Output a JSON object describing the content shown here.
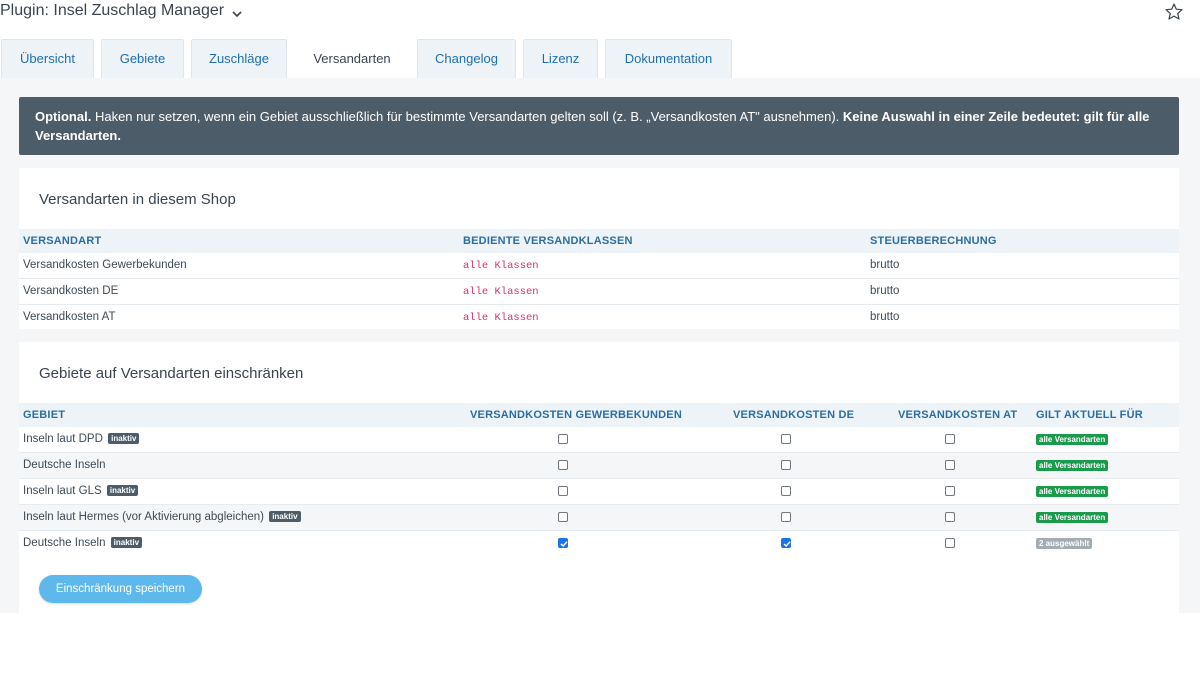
{
  "header": {
    "plugin_title": "Plugin: Insel Zuschlag Manager"
  },
  "tabs": [
    {
      "label": "Übersicht"
    },
    {
      "label": "Gebiete"
    },
    {
      "label": "Zuschläge"
    },
    {
      "label": "Versandarten",
      "active": true
    },
    {
      "label": "Changelog"
    },
    {
      "label": "Lizenz"
    },
    {
      "label": "Dokumentation"
    }
  ],
  "notice": {
    "lead": "Optional.",
    "text": " Haken nur setzen, wenn ein Gebiet ausschließlich für bestimmte Versandarten gelten soll (z. B. „Versandkosten AT\" ausnehmen). ",
    "emphasis": "Keine Auswahl in einer Zeile bedeutet: gilt für alle Versandarten."
  },
  "shipping_methods": {
    "title": "Versandarten in diesem Shop",
    "columns": [
      "VERSANDART",
      "BEDIENTE VERSANDKLASSEN",
      "STEUERBERECHNUNG"
    ],
    "rows": [
      {
        "name": "Versandkosten Gewerbekunden",
        "classes": "alle Klassen",
        "tax": "brutto"
      },
      {
        "name": "Versandkosten DE",
        "classes": "alle Klassen",
        "tax": "brutto"
      },
      {
        "name": "Versandkosten AT",
        "classes": "alle Klassen",
        "tax": "brutto"
      }
    ]
  },
  "restrictions": {
    "title": "Gebiete auf Versandarten einschränken",
    "columns": [
      "GEBIET",
      "VERSANDKOSTEN GEWERBEKUNDEN",
      "VERSANDKOSTEN DE",
      "VERSANDKOSTEN AT",
      "GILT AKTUELL FÜR"
    ],
    "rows": [
      {
        "name": "Inseln laut DPD",
        "badge": "inaktiv",
        "checks": [
          false,
          false,
          false
        ],
        "status": "alle Versandarten"
      },
      {
        "name": "Deutsche Inseln",
        "badge": "",
        "checks": [
          false,
          false,
          false
        ],
        "status": "alle Versandarten"
      },
      {
        "name": "Inseln laut GLS",
        "badge": "inaktiv",
        "checks": [
          false,
          false,
          false
        ],
        "status": "alle Versandarten"
      },
      {
        "name": "Inseln laut Hermes (vor Aktivierung abgleichen)",
        "badge": "inaktiv",
        "checks": [
          false,
          false,
          false
        ],
        "status": "alle Versandarten"
      },
      {
        "name": "Deutsche Inseln",
        "badge": "inaktiv",
        "checks": [
          true,
          true,
          false
        ],
        "status": "2 ausgewählt"
      }
    ],
    "save_label": "Einschränkung speichern"
  },
  "colors": {
    "accent": "#1f6fb0",
    "notice_bg": "#4d5c69",
    "badge_green": "#1a9b4b",
    "badge_grey": "#a3acb5",
    "button": "#5fb8ec"
  }
}
